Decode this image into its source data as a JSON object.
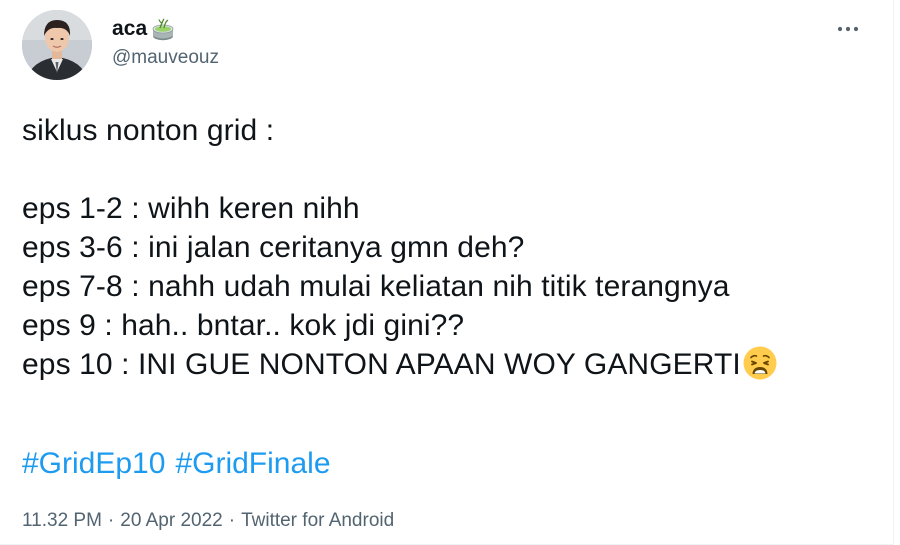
{
  "author": {
    "display_name": "aca",
    "name_emoji": "matcha-drink-icon",
    "handle": "@mauveouz",
    "avatar": "avatar"
  },
  "menu": {
    "more_icon": "more-horizontal-icon"
  },
  "tweet": {
    "lines": [
      "siklus nonton grid :",
      "",
      "eps 1-2 : wihh keren nihh",
      "eps 3-6 : ini jalan ceritanya gmn deh?",
      "eps 7-8 : nahh udah mulai keliatan nih titik terangnya",
      "eps 9 : hah.. bntar.. kok jdi gini??",
      "eps 10 : INI GUE NONTON APAAN WOY GANGERTI"
    ],
    "end_emoji": "weary-face-icon",
    "hashtags": [
      "#GridEp10",
      "#GridFinale"
    ]
  },
  "meta": {
    "time": "11.32 PM",
    "separator": "·",
    "date": "20 Apr 2022",
    "source": "Twitter for Android"
  },
  "colors": {
    "link": "#1d9bf0",
    "secondary_text": "#536471",
    "primary_text": "#0f1419"
  }
}
